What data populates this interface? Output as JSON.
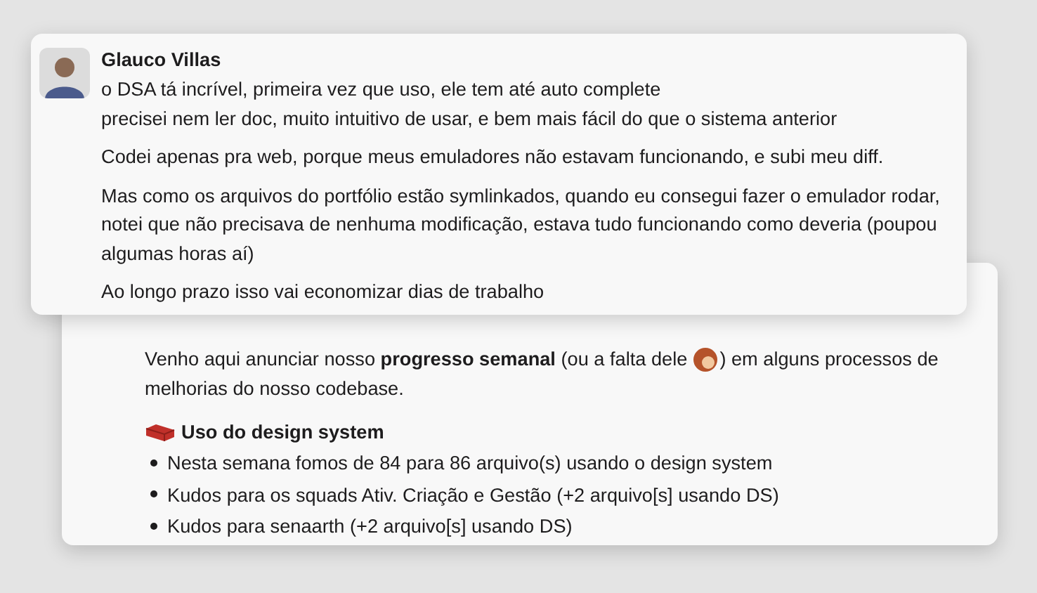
{
  "back_message": {
    "intro_before": "Venho aqui anunciar nosso **progresso semanal** (ou a falta dele",
    "intro_after": ") em alguns processos de",
    "intro_continuation": "melhorias do nosso codebase.",
    "section_title": "Uso do design system",
    "bullets": [
      "Nesta semana fomos de 84 para 86 arquivo(s) usando o design system",
      "Kudos para os squads Ativ. Criação e Gestão (+2 arquivo[s] usando DS)",
      "Kudos para senaarth (+2 arquivo[s] usando DS)"
    ]
  },
  "front_message": {
    "author": "Glauco Villas",
    "paragraphs": [
      [
        "o DSA tá incrível, primeira vez que uso, ele tem até auto complete",
        "precisei nem ler doc, muito intuitivo de usar, e bem mais fácil do que o sistema anterior"
      ],
      [
        "Codei apenas pra web, porque meus emuladores não estavam funcionando, e subi meu diff."
      ],
      [
        "Mas como os arquivos do portfólio estão symlinkados, quando eu consegui fazer o emulador rodar, notei que não precisava de nenhuma modificação, estava tudo funcionando como deveria (poupou algumas horas aí)"
      ],
      [
        "Ao longo prazo isso vai economizar dias de trabalho"
      ]
    ]
  }
}
